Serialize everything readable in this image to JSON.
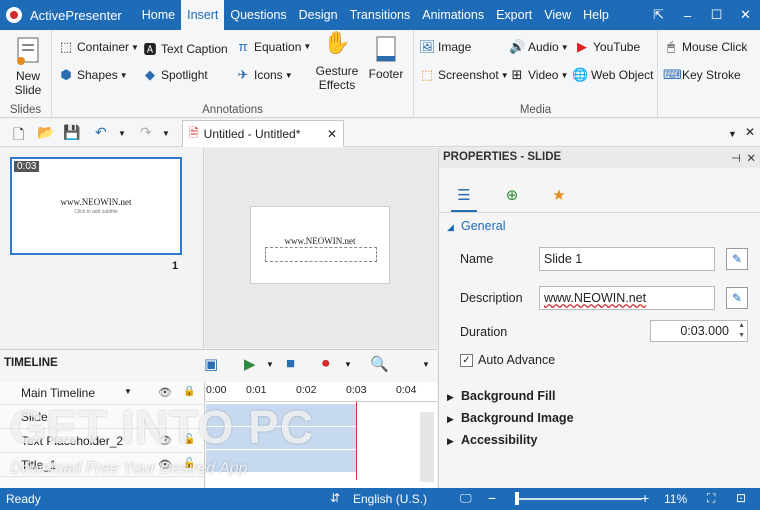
{
  "app": {
    "title": "ActivePresenter"
  },
  "menu": [
    "Home",
    "Insert",
    "Questions",
    "Design",
    "Transitions",
    "Animations",
    "Export",
    "View",
    "Help"
  ],
  "menu_active": "Insert",
  "ribbon": {
    "slides_group": "Slides",
    "new_slide": "New Slide",
    "annotations_group": "Annotations",
    "container": "Container",
    "text_caption": "Text Caption",
    "equation": "Equation",
    "shapes": "Shapes",
    "spotlight": "Spotlight",
    "icons": "Icons",
    "gesture_effects": "Gesture Effects",
    "footer": "Footer",
    "media_group": "Media",
    "image": "Image",
    "audio": "Audio",
    "youtube": "YouTube",
    "screenshot": "Screenshot",
    "video": "Video",
    "web_object": "Web Object",
    "mouse_click": "Mouse Click",
    "key_stroke": "Key Stroke"
  },
  "doc_tab": {
    "label": "Untitled - Untitled*"
  },
  "slides": [
    {
      "number": "1",
      "duration": "0:03",
      "text": "www.NEOWIN.net",
      "sub": "Click to add subtitle"
    }
  ],
  "canvas": {
    "text": "www.NEOWIN.net"
  },
  "properties": {
    "header": "PROPERTIES - SLIDE",
    "general": "General",
    "name_label": "Name",
    "name_value": "Slide 1",
    "description_label": "Description",
    "description_value": "www.NEOWIN.net",
    "duration_label": "Duration",
    "duration_value": "0:03.000",
    "auto_advance": "Auto Advance",
    "auto_advance_checked": true,
    "background_fill": "Background Fill",
    "background_image": "Background Image",
    "accessibility": "Accessibility"
  },
  "timeline": {
    "title": "TIMELINE",
    "rows": [
      "Main Timeline",
      "Slide",
      "Text Placeholder_2",
      "Title_1"
    ],
    "ruler": [
      "0:00",
      "0:01",
      "0:02",
      "0:03",
      "0:04"
    ]
  },
  "status": {
    "ready": "Ready",
    "language": "English (U.S.)",
    "zoom": "11%"
  },
  "watermark": {
    "main": "GET INTO PC",
    "sub": "Download Free Your Desired App"
  },
  "colors": {
    "accent": "#1e6bb8",
    "playhead": "#e03030"
  }
}
